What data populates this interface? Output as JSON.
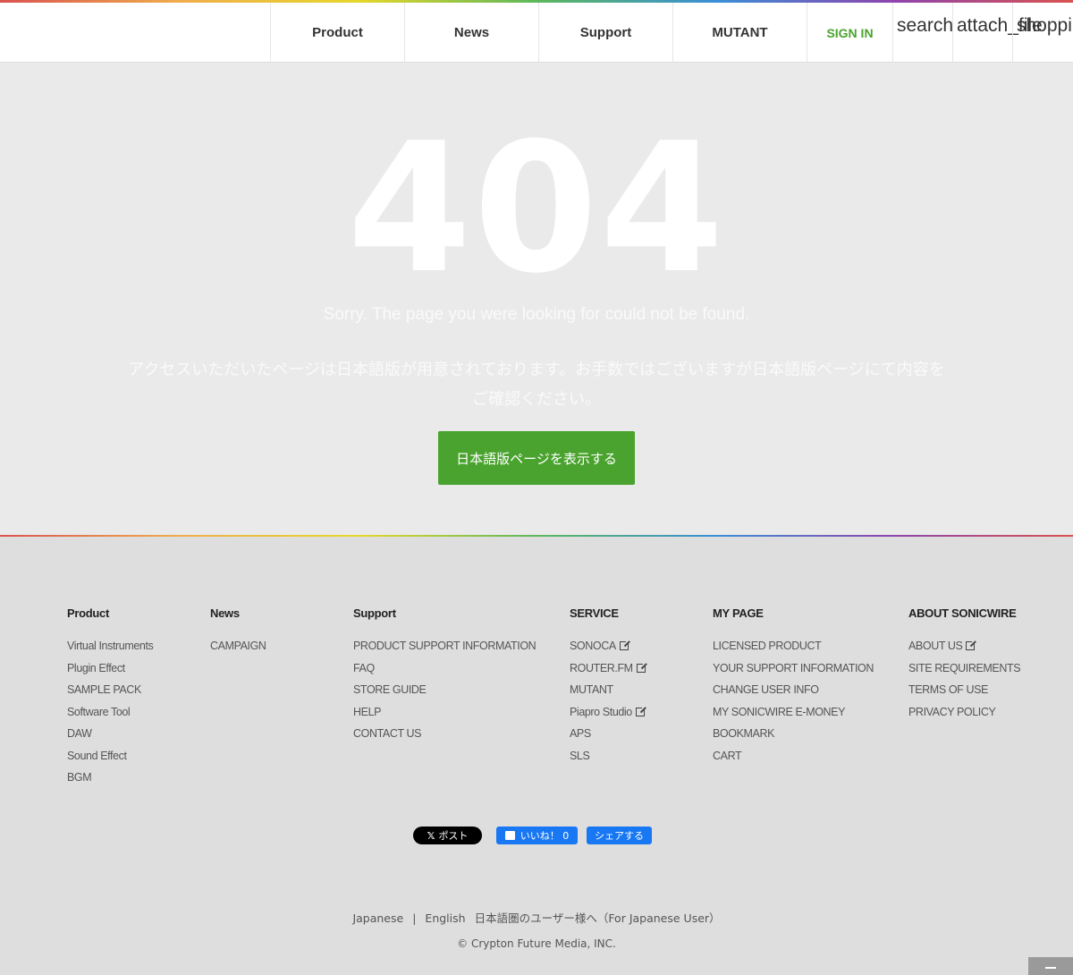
{
  "header": {
    "nav": [
      "Product",
      "News",
      "Support",
      "MUTANT"
    ],
    "signin": "SIGN IN",
    "icons": [
      "search",
      "attach_file",
      "shopping_cart"
    ]
  },
  "main": {
    "code": "404",
    "sorry": "Sorry. The page you were looking for could not be found.",
    "jp_message": "アクセスいただいたページは日本語版が用意されております。お手数ではございますが日本語版ページにて内容をご確認ください。",
    "jp_button": "日本語版ページを表示する"
  },
  "footer": {
    "columns": [
      {
        "title": "Product",
        "items": [
          "Virtual Instruments",
          "Plugin Effect",
          "SAMPLE PACK",
          "Software Tool",
          "DAW",
          "Sound Effect",
          "BGM"
        ]
      },
      {
        "title": "News",
        "items": [
          "CAMPAIGN"
        ]
      },
      {
        "title": "Support",
        "items": [
          "PRODUCT SUPPORT INFORMATION",
          "FAQ",
          "STORE GUIDE",
          "HELP",
          "CONTACT US"
        ]
      },
      {
        "title": "SERVICE",
        "items": [
          "SONOCA",
          "ROUTER.FM",
          "MUTANT",
          "Piapro Studio",
          "APS",
          "SLS"
        ]
      },
      {
        "title": "MY PAGE",
        "items": [
          "LICENSED PRODUCT",
          "YOUR SUPPORT INFORMATION",
          "CHANGE USER INFO",
          "MY SONICWIRE E-MONEY",
          "BOOKMARK",
          "CART"
        ]
      },
      {
        "title": "ABOUT SONICWIRE",
        "items": [
          "ABOUT US",
          "SITE REQUIREMENTS",
          "TERMS OF USE",
          "PRIVACY POLICY"
        ]
      }
    ],
    "social": {
      "x_post": "ポスト",
      "fb_like": "いいね！ 0",
      "fb_share": "シェアする"
    },
    "lang": {
      "japanese": "Japanese",
      "sep": "|",
      "english": "English",
      "jp_user": "日本語圏のユーザー様へ（For Japanese User）"
    },
    "copyright": "© Crypton Future Media, INC."
  }
}
